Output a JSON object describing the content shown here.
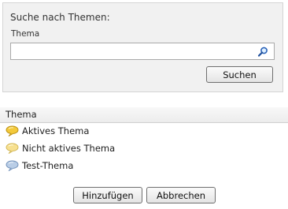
{
  "search": {
    "title": "Suche nach Themen:",
    "field_label": "Thema",
    "value": "",
    "placeholder": "",
    "button_label": "Suchen"
  },
  "list": {
    "header": "Thema",
    "items": [
      {
        "label": "Aktives Thema",
        "icon": "speech-bubble-yellow-icon",
        "color": "#f3c93a"
      },
      {
        "label": "Nicht aktives Thema",
        "icon": "speech-bubble-pale-yellow-icon",
        "color": "#f7e08f"
      },
      {
        "label": "Test-Thema",
        "icon": "speech-bubble-blue-icon",
        "color": "#b9cde6"
      }
    ]
  },
  "footer": {
    "add_label": "Hinzufügen",
    "cancel_label": "Abbrechen"
  }
}
